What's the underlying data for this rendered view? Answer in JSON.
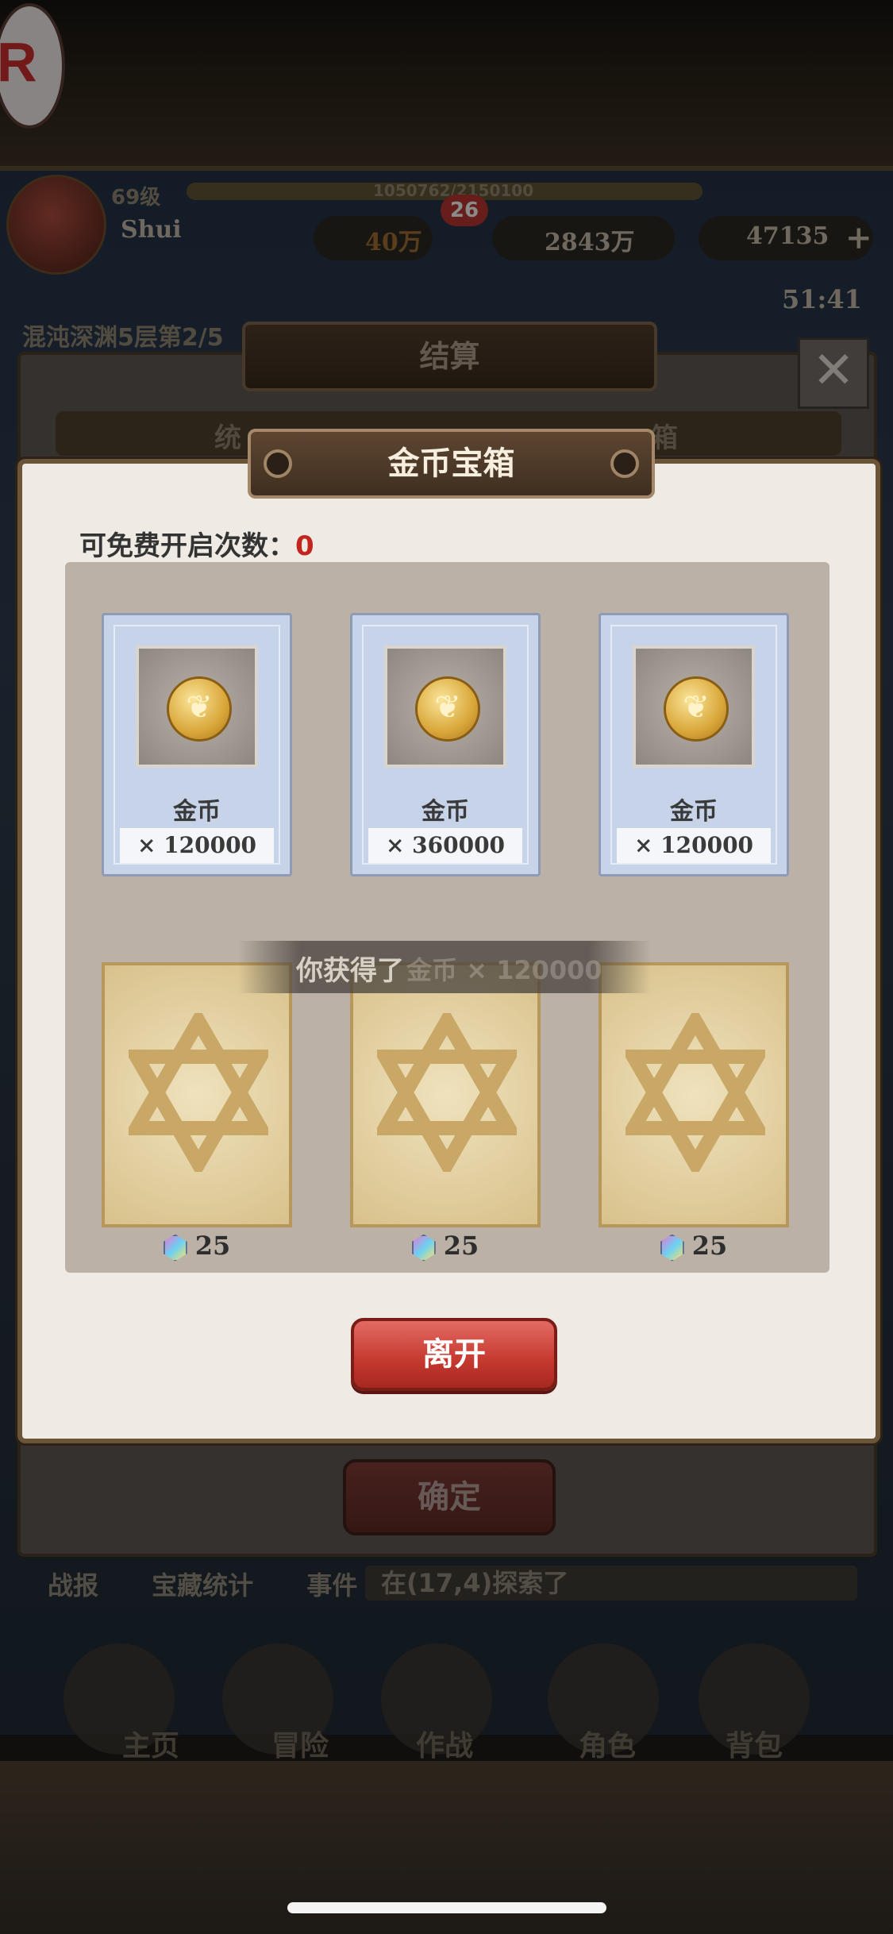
{
  "background": {
    "hud": {
      "level": "69级",
      "player_name": "Shui",
      "exp_text": "1050762/2150100",
      "power": "40万",
      "gold": "2843万",
      "gems": "47135",
      "plus_symbol": "+",
      "mail_badge": "26",
      "timer": "51:41",
      "stage": "混沌深渊5层第2/5"
    },
    "result_panel": {
      "title": "结算",
      "tab_left": "统",
      "tab_right": "箱",
      "confirm_label": "确定",
      "close_symbol": "✕"
    },
    "bottom_tabs": [
      "战报",
      "宝藏统计",
      "事件"
    ],
    "explore_text": "在(17,4)探索了",
    "nav": [
      "主页",
      "冒险",
      "作战",
      "角色",
      "背包"
    ]
  },
  "dialog": {
    "title": "金币宝箱",
    "free_label": "可免费开启次数：",
    "free_count": "0",
    "rewards": [
      {
        "name": "金币",
        "qty": "× 120000",
        "icon": "gold-coin-icon"
      },
      {
        "name": "金币",
        "qty": "× 360000",
        "icon": "gold-coin-icon"
      },
      {
        "name": "金币",
        "qty": "× 120000",
        "icon": "gold-coin-icon"
      }
    ],
    "unopened": [
      {
        "price": "25",
        "icon": "diamond-gem-icon"
      },
      {
        "price": "25",
        "icon": "diamond-gem-icon"
      },
      {
        "price": "25",
        "icon": "diamond-gem-icon"
      }
    ],
    "toast": "你获得了",
    "toast_faded": "金币 × 120000",
    "leave_label": "离开"
  },
  "colors": {
    "accent_red": "#c4382f",
    "count_red": "#c2271f",
    "panel_bg": "#efebe4",
    "grid_bg": "#bbb1a6"
  }
}
